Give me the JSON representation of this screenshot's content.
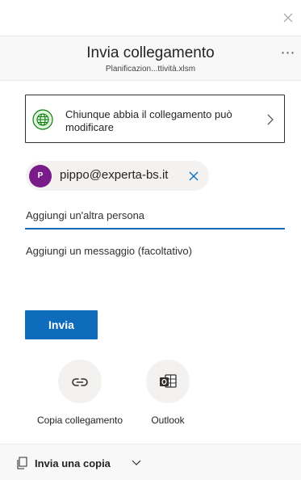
{
  "dialog": {
    "title": "Invia collegamento",
    "file_name": "Planificazion...ttività.xlsm",
    "more_icon": "ellipsis-icon",
    "close_icon": "close-icon"
  },
  "permission": {
    "text": "Chiunque abbia il collegamento può modificare",
    "icon": "globe-icon",
    "chevron": "chevron-right-icon"
  },
  "recipients": [
    {
      "initial": "P",
      "email": "pippo@experta-bs.it",
      "avatar_color": "#7a1b8a"
    }
  ],
  "add_person": {
    "placeholder": "Aggiungi un'altra persona",
    "value": ""
  },
  "message": {
    "placeholder": "Aggiungi un messaggio (facoltativo)",
    "value": ""
  },
  "send_button": {
    "label": "Invia"
  },
  "share_options": [
    {
      "label": "Copia collegamento",
      "icon": "link-icon"
    },
    {
      "label": "Outlook",
      "icon": "outlook-icon"
    }
  ],
  "footer": {
    "label": "Invia una copia",
    "icon": "copy-document-icon",
    "chevron": "chevron-down-icon"
  },
  "colors": {
    "accent": "#0f6cbd",
    "header_bg": "#f8f8f8",
    "chip_bg": "#f3f2f1"
  }
}
